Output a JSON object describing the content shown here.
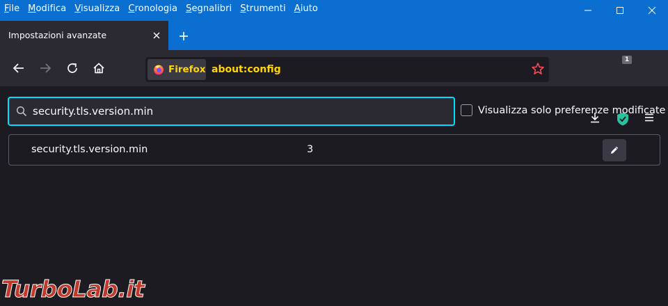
{
  "menubar": {
    "items": [
      {
        "mnemonic": "F",
        "rest": "ile"
      },
      {
        "mnemonic": "M",
        "rest": "odifica"
      },
      {
        "mnemonic": "V",
        "rest": "isualizza"
      },
      {
        "mnemonic": "C",
        "rest": "ronologia"
      },
      {
        "mnemonic": "S",
        "rest": "egnalibri"
      },
      {
        "mnemonic": "S",
        "rest": "trumenti"
      },
      {
        "mnemonic": "A",
        "rest": "iuto"
      }
    ]
  },
  "tab": {
    "title": "Impostazioni avanzate"
  },
  "urlbar": {
    "identity_label": "Firefox",
    "url": "about:config"
  },
  "toolbar": {
    "extension_badge": "1"
  },
  "search": {
    "value": "security.tls.version.min"
  },
  "filter": {
    "label": "Visualizza solo preferenze modificate",
    "checked": false
  },
  "preferences": [
    {
      "name": "security.tls.version.min",
      "value": "3"
    }
  ],
  "watermark": {
    "part1": "Turbo",
    "part2": "Lab.it"
  },
  "colors": {
    "titlebar": "#0a6fd0",
    "accent_focus": "#00ddff",
    "url_highlight": "#ffd50a"
  }
}
